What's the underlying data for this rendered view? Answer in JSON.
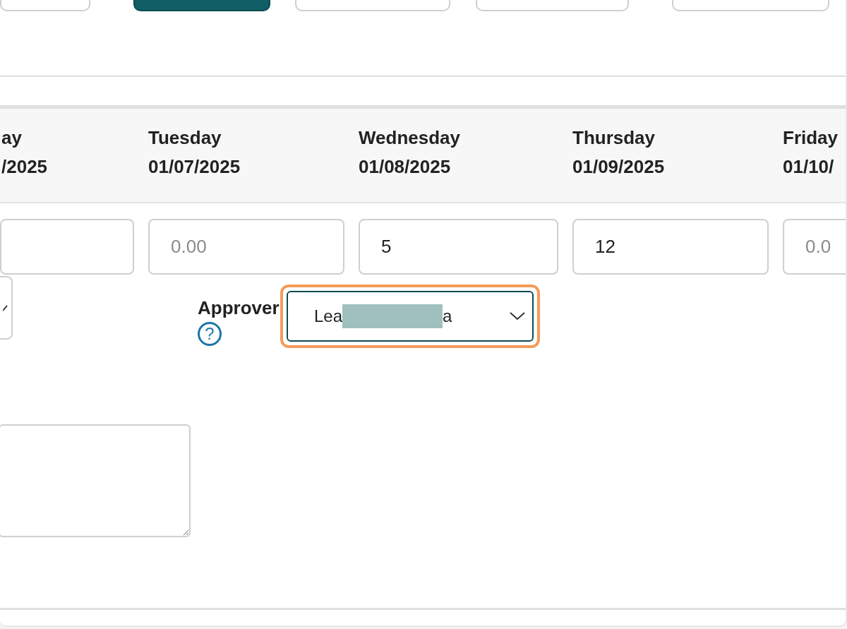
{
  "toolbar": {
    "buttons": [
      {
        "kind": "secondary"
      },
      {
        "kind": "primary"
      },
      {
        "kind": "secondary"
      },
      {
        "kind": "secondary"
      },
      {
        "kind": "secondary"
      }
    ]
  },
  "days": [
    {
      "name": "ay",
      "date": "/2025"
    },
    {
      "name": "Tuesday",
      "date": "01/07/2025",
      "hours": {
        "placeholder": "0.00"
      }
    },
    {
      "name": "Wednesday",
      "date": "01/08/2025",
      "hours": {
        "value": "5"
      }
    },
    {
      "name": "Thursday",
      "date": "01/09/2025",
      "hours": {
        "value": "12"
      }
    },
    {
      "name": "Friday",
      "date": "01/10/",
      "hours": {
        "placeholder": "0.0"
      }
    }
  ],
  "approver": {
    "label": "Approver",
    "help": "?",
    "value_start": "Lea",
    "value_end": "a",
    "focused": true
  }
}
